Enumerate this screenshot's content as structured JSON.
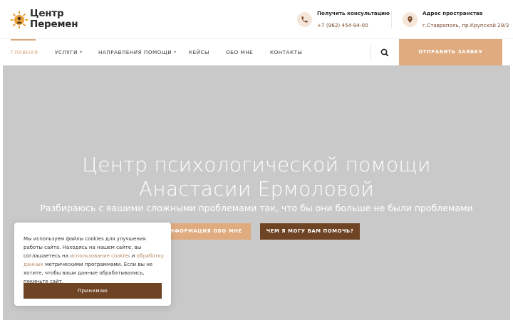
{
  "brand": {
    "logo_line1": "Центр",
    "logo_line2": "Перемен",
    "logo_icon": "sun-figure-logo"
  },
  "header": {
    "phone": {
      "icon": "phone-icon",
      "title": "Получить консультацию",
      "value": "+7 (962) 454-94-00"
    },
    "address": {
      "icon": "location-pin-icon",
      "title": "Адрес пространства",
      "value": "г.Ставрополь, пр.Крупской 29/3"
    }
  },
  "nav": {
    "items": [
      {
        "label": "ГЛАВНАЯ",
        "active": true
      },
      {
        "label": "УСЛУГИ",
        "dropdown": true
      },
      {
        "label": "НАПРАВЛЕНИЯ ПОМОЩИ",
        "dropdown": true
      },
      {
        "label": "КЕЙСЫ"
      },
      {
        "label": "ОБО МНЕ"
      },
      {
        "label": "КОНТАКТЫ"
      }
    ],
    "search_icon": "search-icon",
    "cta_label": "ОТПРАВИТЬ ЗАЯВКУ"
  },
  "hero": {
    "title_line1": "Центр психологической помощи",
    "title_line2": "Анастасии Ермоловой",
    "subtitle": "Разбираюсь с вашими сложными проблемами так, что бы они больше не были проблемами",
    "button1": "ИНФОРМАЦИЯ ОБО МНЕ",
    "button2": "ЧЕМ Я МОГУ ВАМ ПОМОЧЬ?"
  },
  "cookie": {
    "text_1": "Мы используем файлы cookies для улучшения работы сайта. Находясь на нашем сайте, вы соглашаетесь на ",
    "link_1": "использование cookies",
    "text_2": " и ",
    "link_2": "обработку данных",
    "text_3": " метрическими программами. Если вы не хотите, чтобы ваши данные обрабатывались, покиньте сайт.",
    "button": "Принимаю"
  },
  "colors": {
    "accent": "#e0ab7f",
    "dark_brown": "#6f4424",
    "hero_bg": "#c9c9c9"
  }
}
